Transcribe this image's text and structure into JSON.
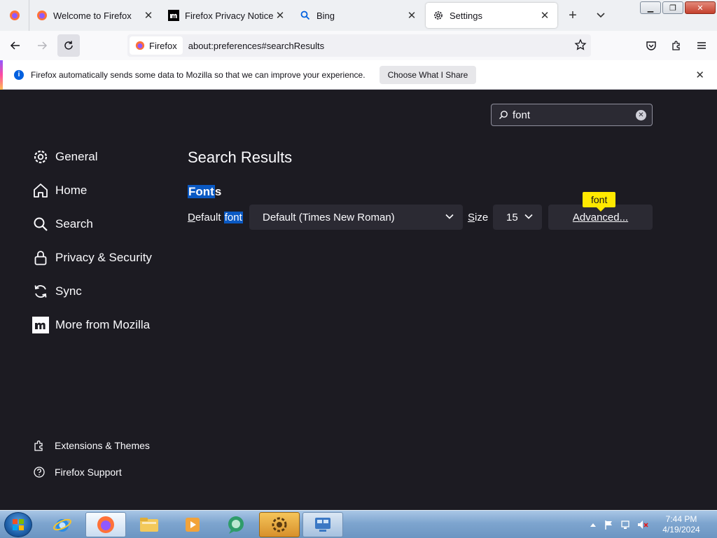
{
  "browser": {
    "tabs": [
      {
        "title": "Welcome to Firefox",
        "active": false
      },
      {
        "title": "Firefox Privacy Notice —",
        "active": false
      },
      {
        "title": "Bing",
        "active": false
      },
      {
        "title": "Settings",
        "active": true
      }
    ],
    "identity_label": "Firefox",
    "url": "about:preferences#searchResults"
  },
  "notification": {
    "message": "Firefox automatically sends some data to Mozilla so that we can improve your experience.",
    "button_label": "Choose What I Share",
    "info_glyph": "i"
  },
  "settings": {
    "search_value": "font",
    "categories": [
      {
        "label": "General",
        "icon": "gear-icon"
      },
      {
        "label": "Home",
        "icon": "home-icon"
      },
      {
        "label": "Search",
        "icon": "search-icon"
      },
      {
        "label": "Privacy & Security",
        "icon": "lock-icon"
      },
      {
        "label": "Sync",
        "icon": "sync-icon"
      },
      {
        "label": "More from Mozilla",
        "icon": "mozilla-icon"
      }
    ],
    "footer": [
      {
        "label": "Extensions & Themes",
        "icon": "puzzle-icon"
      },
      {
        "label": "Firefox Support",
        "icon": "help-icon"
      }
    ],
    "results_title": "Search Results",
    "section": {
      "heading_highlight": "Font",
      "heading_rest": "s"
    },
    "default_font": {
      "label_prefix": "D",
      "label_middle": "efault ",
      "label_highlight": "font",
      "value": "Default (Times New Roman)"
    },
    "size": {
      "label_access": "S",
      "label_rest": "ize",
      "value": "15"
    },
    "advanced": {
      "access": "A",
      "rest": "dvanced..."
    },
    "tooltip": "font"
  },
  "taskbar": {
    "time": "7:44 PM",
    "date": "4/19/2024"
  },
  "colors": {
    "accent": "#0a59c3",
    "tooltip": "#ffe900",
    "content_bg": "#1c1b22"
  }
}
